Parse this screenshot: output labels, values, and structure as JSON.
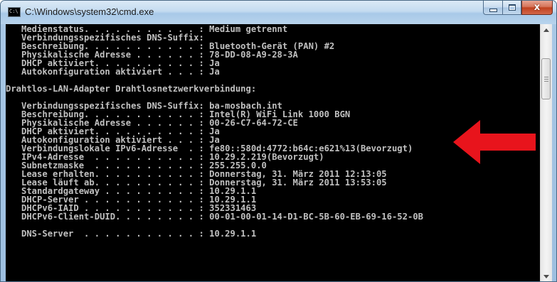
{
  "window": {
    "title": "C:\\Windows\\system32\\cmd.exe",
    "icon_text": "C:\\"
  },
  "caption_buttons": {
    "close_label": "x"
  },
  "console": {
    "lines": [
      "   Medienstatus. . . . . . . . . . . : Medium getrennt",
      "   Verbindungsspezifisches DNS-Suffix:",
      "   Beschreibung. . . . . . . . . . . : Bluetooth-Gerät (PAN) #2",
      "   Physikalische Adresse . . . . . . : 78-DD-08-A9-28-3A",
      "   DHCP aktiviert. . . . . . . . . . : Ja",
      "   Autokonfiguration aktiviert . . . : Ja",
      "",
      "Drahtlos-LAN-Adapter Drahtlosnetzwerkverbindung:",
      "",
      "   Verbindungsspezifisches DNS-Suffix: ba-mosbach.int",
      "   Beschreibung. . . . . . . . . . . : Intel(R) WiFi Link 1000 BGN",
      "   Physikalische Adresse . . . . . . : 00-26-C7-64-72-CE",
      "   DHCP aktiviert. . . . . . . . . . : Ja",
      "   Autokonfiguration aktiviert . . . : Ja",
      "   Verbindungslokale IPv6-Adresse  . : fe80::580d:4772:b64c:e621%13(Bevorzugt)",
      "   IPv4-Adresse  . . . . . . . . . . : 10.29.2.219(Bevorzugt)",
      "   Subnetzmaske  . . . . . . . . . . : 255.255.0.0",
      "   Lease erhalten. . . . . . . . . . : Donnerstag, 31. März 2011 12:13:05",
      "   Lease läuft ab. . . . . . . . . . : Donnerstag, 31. März 2011 13:53:05",
      "   Standardgateway . . . . . . . . . : 10.29.1.1",
      "   DHCP-Server . . . . . . . . . . . : 10.29.1.1",
      "   DHCPv6-IAID . . . . . . . . . . . : 352331463",
      "   DHCPv6-Client-DUID. . . . . . . . : 00-01-00-01-14-D1-BC-5B-60-EB-69-16-52-0B",
      "",
      "   DNS-Server  . . . . . . . . . . . : 10.29.1.1"
    ]
  },
  "annotation": {
    "arrow_color": "#e8141c",
    "points_to": "Intel(R) WiFi Link 1000 BGN"
  },
  "colors": {
    "console_background": "#000000",
    "console_text": "#c0c0c0",
    "close_button": "#c7472a",
    "frame": "#a9c8e6"
  },
  "scrollbar": {
    "icons": [
      "scroll-up-arrow-icon",
      "scroll-down-arrow-icon",
      "grip-icon"
    ]
  }
}
